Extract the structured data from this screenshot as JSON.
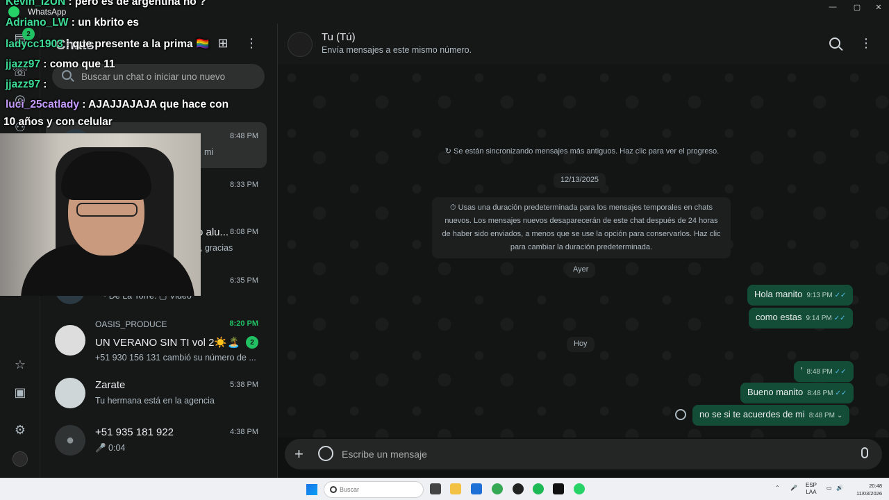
{
  "window": {
    "app_name": "WhatsApp",
    "controls": [
      "—",
      "▢",
      "✕"
    ]
  },
  "rail": {
    "badge_count": "2"
  },
  "list": {
    "title": "Chats",
    "search_placeholder": "Buscar un chat o iniciar uno nuevo",
    "rows": [
      {
        "name": "",
        "preview": "mi",
        "time": "8:48 PM"
      },
      {
        "name": "",
        "preview": "",
        "time": "8:33 PM"
      },
      {
        "name": "o alu...",
        "preview": ", gracias",
        "time": "8:08 PM"
      },
      {
        "name": "",
        "preview": "~ De La Torre: ▢ Video",
        "time": "6:35 PM"
      },
      {
        "group": "OASIS_PRODUCE",
        "name": "UN VERANO SIN TI vol 2☀️🏝️",
        "preview": "+51 930 156 131 cambió su número de ...",
        "time": "8:20 PM",
        "unread": "2"
      },
      {
        "name": "Zarate",
        "preview": "Tu hermana está en la agencia",
        "time": "5:38 PM"
      },
      {
        "name": "+51 935 181 922",
        "preview": "🎤 0:04",
        "time": "4:38 PM"
      }
    ]
  },
  "chat": {
    "contact_name": "Tu (Tú)",
    "contact_sub": "Envía mensajes a este mismo número.",
    "sync_note": "↻ Se están sincronizando mensajes más antiguos. Haz clic para ver el progreso.",
    "date_1": "12/13/2025",
    "info_text": "⏱ Usas una duración predeterminada para los mensajes temporales en chats nuevos. Los mensajes nuevos desaparecerán de este chat después de 24 horas de haber sido enviados, a menos que se use la opción para conservarlos. Haz clic para cambiar la duración predeterminada.",
    "date_2": "Ayer",
    "date_3": "Hoy",
    "messages": [
      {
        "text": "Hola manito",
        "time": "9:13 PM",
        "ticks": "✓✓"
      },
      {
        "text": "como estas",
        "time": "9:14 PM",
        "ticks": "✓✓"
      },
      {
        "text": "'",
        "time": "8:48 PM",
        "ticks": "✓✓"
      },
      {
        "text": "Bueno manito",
        "time": "8:48 PM",
        "ticks": "✓✓"
      },
      {
        "text": "no se si te acuerdes de mi",
        "time": "8:48 PM",
        "ticks": "⌄"
      }
    ],
    "composer_placeholder": "Escribe un mensaje"
  },
  "overlay": {
    "lines": [
      {
        "user": "Kevin_I2UN",
        "text": " : pero es de argentina no ?",
        "color": "#3ddc97"
      },
      {
        "user": "Adriano_LW",
        "text": " : un kbrito es",
        "color": "#3ddc97"
      },
      {
        "user": "ladycc1903",
        "text": " : que presente a la prima 🏳️‍🌈",
        "color": "#3ddc97"
      },
      {
        "user": "jjazz97",
        "text": " : como que 11",
        "color": "#3ddc97"
      },
      {
        "user": "jjazz97",
        "text": " : ",
        "color": "#3ddc97"
      },
      {
        "user": "luci_25catlady",
        "text": " : AJAJJAJAJA que hace con",
        "color": "#c59bff"
      },
      {
        "user": "",
        "text": "10 años y con celular",
        "color": "#ffffff"
      }
    ]
  },
  "taskbar": {
    "search_placeholder": "Buscar",
    "lang_top": "ESP",
    "lang_bottom": "LAA",
    "time": "20:48",
    "date": "11/03/2026"
  }
}
